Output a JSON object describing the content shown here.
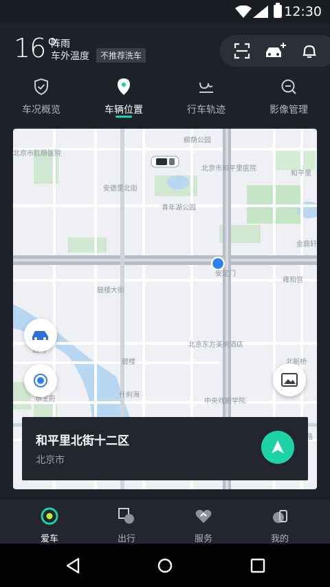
{
  "status_bar": {
    "time": "12:30"
  },
  "header": {
    "temperature": "16°",
    "weather": "阵雨",
    "temp_label": "车外温度",
    "wash_badge": "不推荐洗车",
    "icons": [
      "scan-icon",
      "car-add-icon",
      "bell-icon"
    ]
  },
  "tabs": [
    {
      "label": "车况概览",
      "icon": "shield-check-icon"
    },
    {
      "label": "车辆位置",
      "icon": "location-pin-icon",
      "active": true
    },
    {
      "label": "行车轨迹",
      "icon": "route-icon"
    },
    {
      "label": "影像管理",
      "icon": "zoom-out-icon"
    }
  ],
  "map": {
    "labels": {
      "park_liuyin": "柳荫公园",
      "hospital_anorectal": "北京市肛肠医院",
      "hospital_hepingli": "北京市和平里医院",
      "hepingli_short": "和平里",
      "andeli_street": "安德里北街",
      "qingnianhu_park": "青年湖公园",
      "jindingxuan": "金鼎轩",
      "andingmen": "安定门",
      "yonghegong": "雍和宫",
      "gulou_street": "鼓楼大街",
      "dongfang_hotel": "北京东方美尚酒店",
      "gulou": "鼓楼",
      "beixinqiao": "北新桥",
      "houhai": "后海",
      "shichahai": "什刹海",
      "gongwangfu": "恭王府",
      "drama_academy": "中央戏剧学院",
      "lu": "路"
    }
  },
  "address_card": {
    "name": "和平里北街十二区",
    "city": "北京市"
  },
  "bottom_nav": [
    {
      "label": "爱车",
      "icon": "car-ring-icon",
      "active": true
    },
    {
      "label": "出行",
      "icon": "travel-icon"
    },
    {
      "label": "服务",
      "icon": "heart-service-icon"
    },
    {
      "label": "我的",
      "icon": "profile-icon"
    }
  ],
  "colors": {
    "accent": "#19d3b4",
    "nav_button": "#1bd3a7",
    "location_dot": "#2f80ed"
  }
}
